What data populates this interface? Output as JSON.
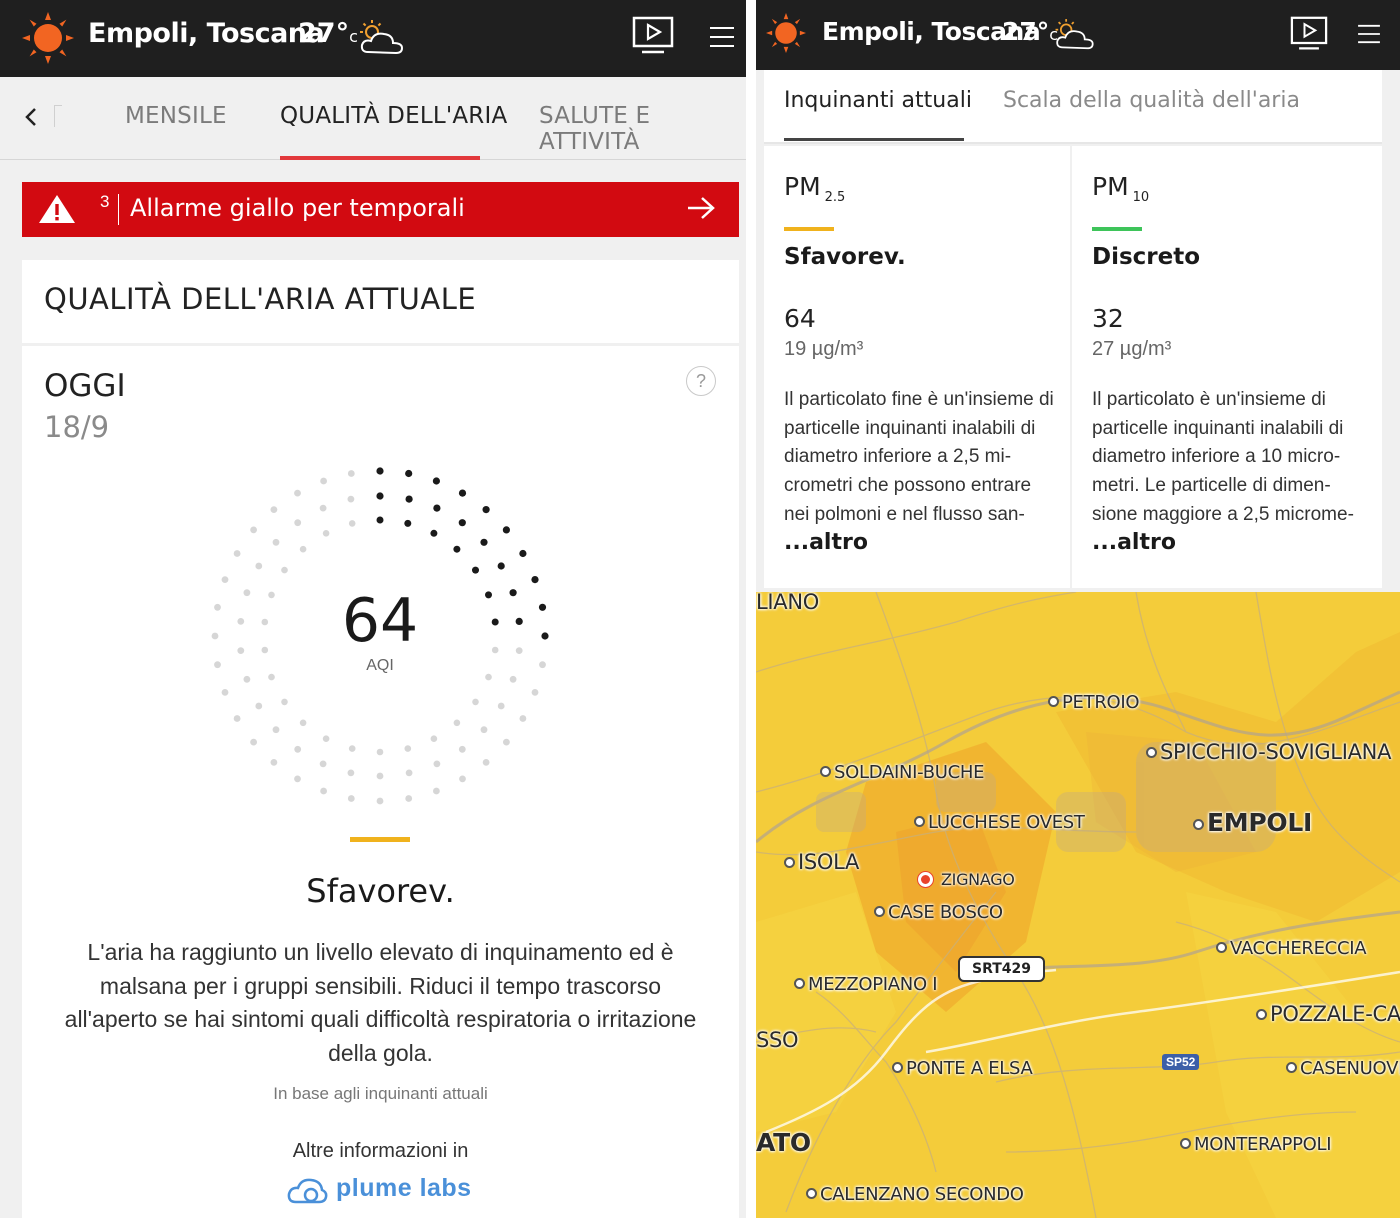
{
  "header": {
    "location": "Empoli, Toscana",
    "temperature": "27°",
    "temperature_unit": "c",
    "weather_icon": "partly-cloudy-icon",
    "colors": {
      "bar": "#1f1f1f",
      "sun": "#f26522"
    }
  },
  "left": {
    "tabs": [
      {
        "label": "MENSILE",
        "active": false
      },
      {
        "label": "QUALITÀ DELL'ARIA",
        "active": true
      },
      {
        "label": "SALUTE E ATTIVITÀ",
        "active": false
      }
    ],
    "alert": {
      "count": "3",
      "text": "Allarme giallo per temporali",
      "color": "#d20a11"
    },
    "section_title": "QUALITÀ DELL'ARIA ATTUALE",
    "day_label": "OGGI",
    "date": "18/9",
    "help_symbol": "?",
    "aqi": {
      "value": "64",
      "label": "AQI",
      "fill_fraction": 0.21
    },
    "level": {
      "name": "Sfavorev.",
      "color": "#f0b21d"
    },
    "description": "L'aria ha raggiunto un livello elevato di inquinamento ed è malsana per i gruppi sensibili. Riduci il tempo trascorso all'aperto se hai sintomi quali difficoltà respiratoria o irritazione della gola.",
    "basis": "In base agli inquinanti attuali",
    "more_info": "Altre informazioni in",
    "provider": "plume labs"
  },
  "right": {
    "tabs": [
      {
        "label": "Inquinanti attuali",
        "active": true
      },
      {
        "label": "Scala della qualità dell'aria",
        "active": false
      }
    ],
    "pollutants": [
      {
        "name": "PM",
        "sub": "2.5",
        "level": "Sfavorev.",
        "color": "#f0b21d",
        "value": "64",
        "concentration": "19 µg/m³",
        "description": "Il particolato fine è un'insieme di particelle inquinanti inalabili di diametro inferiore a 2,5 mi-crometri che possono entrare nei polmoni e nel flusso san-",
        "more": "...altro"
      },
      {
        "name": "PM",
        "sub": "10",
        "level": "Discreto",
        "color": "#3ec45a",
        "value": "32",
        "concentration": "27 µg/m³",
        "description": "Il particolato è un'insieme di particelle inquinanti inalabili di diametro inferiore a 10 micro-metri. Le particelle di dimen-sione maggiore a 2,5 microme-",
        "more": "...altro"
      }
    ],
    "map": {
      "places": [
        {
          "id": "liano",
          "label": "LIANO"
        },
        {
          "id": "petroio",
          "label": "PETROIO"
        },
        {
          "id": "spicchio",
          "label": "SPICCHIO-SOVIGLIANA"
        },
        {
          "id": "soldaini",
          "label": "SOLDAINI-BUCHE"
        },
        {
          "id": "lucchese",
          "label": "LUCCHESE OVEST"
        },
        {
          "id": "empoli",
          "label": "EMPOLI"
        },
        {
          "id": "isola",
          "label": "ISOLA"
        },
        {
          "id": "zignago",
          "label": "ZIGNAGO"
        },
        {
          "id": "casebosco",
          "label": "CASE BOSCO"
        },
        {
          "id": "vaccherecc",
          "label": "VACCHERECCIA"
        },
        {
          "id": "mezzopiano",
          "label": "MEZZOPIANO I"
        },
        {
          "id": "pozzale",
          "label": "POZZALE-CAS"
        },
        {
          "id": "sso",
          "label": "SSO"
        },
        {
          "id": "ponteaelsa",
          "label": "PONTE A ELSA"
        },
        {
          "id": "casenuove",
          "label": "CASENUOVE"
        },
        {
          "id": "ato",
          "label": "ATO"
        },
        {
          "id": "monterappoli",
          "label": "MONTERAPPOLI"
        },
        {
          "id": "calenzano",
          "label": "CALENZANO SECONDO"
        }
      ],
      "road_shields": {
        "srt": "SRT429",
        "sp": "SP52"
      },
      "colors": {
        "base": "#f4cc3a",
        "hot": "#f0ad2e"
      }
    }
  }
}
